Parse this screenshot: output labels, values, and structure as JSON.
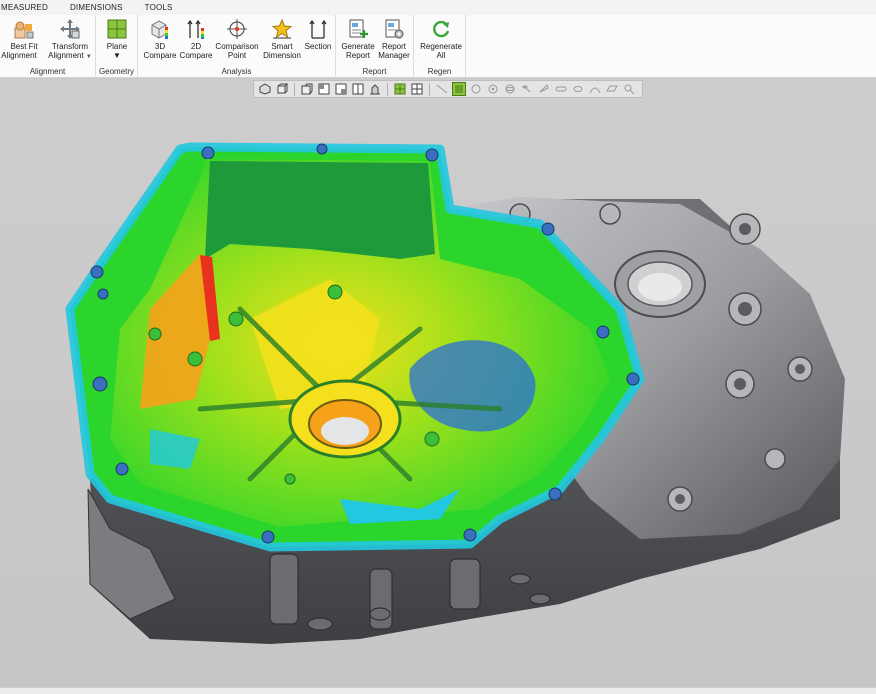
{
  "menu_tabs": [
    "MEASURED",
    "DIMENSIONS",
    "TOOLS"
  ],
  "ribbon": {
    "groups": [
      {
        "label": "Alignment",
        "buttons": [
          {
            "l1": "Best Fit",
            "l2": "t Alignment"
          },
          {
            "l1": "Transform",
            "l2": "Alignment"
          }
        ]
      },
      {
        "label": "Geometry",
        "buttons": [
          {
            "l1": "Plane",
            "l2": ""
          }
        ]
      },
      {
        "label": "Analysis",
        "buttons": [
          {
            "l1": "3D",
            "l2": "Compare"
          },
          {
            "l1": "2D",
            "l2": "Compare"
          },
          {
            "l1": "Comparison",
            "l2": "Point"
          },
          {
            "l1": "Smart",
            "l2": "Dimension"
          },
          {
            "l1": "Section",
            "l2": ""
          }
        ]
      },
      {
        "label": "Report",
        "buttons": [
          {
            "l1": "Generate",
            "l2": "Report"
          },
          {
            "l1": "Report",
            "l2": "Manager"
          }
        ]
      },
      {
        "label": "Regen",
        "buttons": [
          {
            "l1": "Regenerate",
            "l2": "All"
          }
        ]
      }
    ]
  },
  "colors": {
    "deviation_green": "#2bd52b",
    "deviation_yellow": "#f4e01c",
    "deviation_orange": "#f5a21a",
    "deviation_red": "#e8321e",
    "deviation_cyan": "#22c8e0",
    "deviation_blue": "#2a6fd8",
    "cad_gray": "#7d7f83"
  }
}
